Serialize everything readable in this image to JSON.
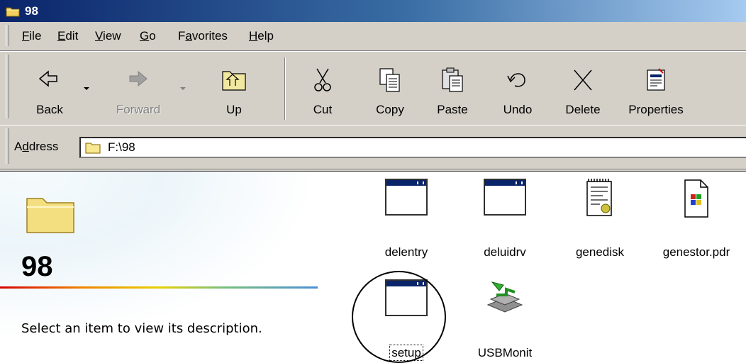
{
  "window": {
    "title": "98",
    "icon": "folder-icon"
  },
  "menu": {
    "items": [
      {
        "label": "File",
        "accel": "F"
      },
      {
        "label": "Edit",
        "accel": "E"
      },
      {
        "label": "View",
        "accel": "V"
      },
      {
        "label": "Go",
        "accel": "G"
      },
      {
        "label": "Favorites",
        "accel": "a"
      },
      {
        "label": "Help",
        "accel": "H"
      }
    ]
  },
  "toolbar": {
    "back": "Back",
    "forward": "Forward",
    "up": "Up",
    "cut": "Cut",
    "copy": "Copy",
    "paste": "Paste",
    "undo": "Undo",
    "delete": "Delete",
    "properties": "Properties"
  },
  "address": {
    "label": "Address",
    "value": "F:\\98"
  },
  "left_pane": {
    "folder_name": "98",
    "description": "Select an item to view its description."
  },
  "files": [
    {
      "name": "delentry",
      "icon": "app-window-icon"
    },
    {
      "name": "deluidrv",
      "icon": "app-window-icon"
    },
    {
      "name": "genedisk",
      "icon": "config-file-icon"
    },
    {
      "name": "genestor.pdr",
      "icon": "driver-file-icon"
    },
    {
      "name": "setup",
      "icon": "app-window-icon",
      "selected": true
    },
    {
      "name": "USBMonit",
      "icon": "usb-monitor-icon"
    }
  ],
  "colors": {
    "titlebar_start": "#0a246a",
    "titlebar_end": "#a6caf0",
    "chrome": "#d4d0c8"
  }
}
